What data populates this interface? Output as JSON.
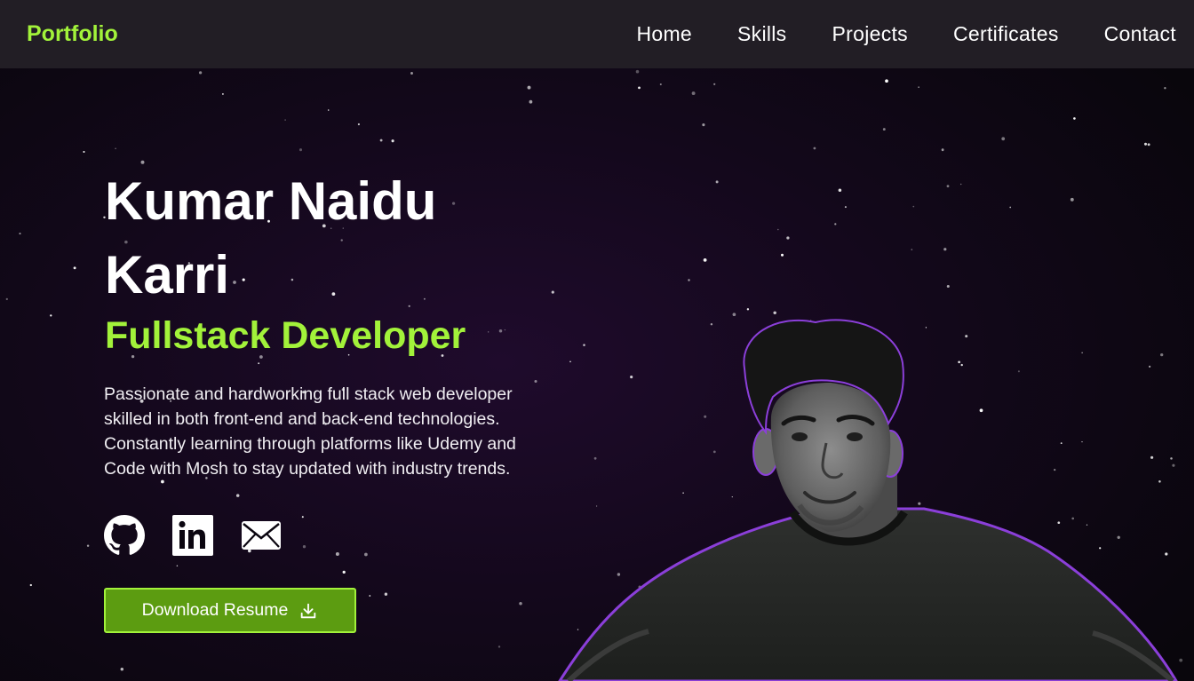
{
  "nav": {
    "brand": "Portfolio",
    "links": [
      "Home",
      "Skills",
      "Projects",
      "Certificates",
      "Contact"
    ]
  },
  "hero": {
    "name": "Kumar Naidu Karri",
    "role": "Fullstack Developer",
    "bio": "Passionate and hardworking full stack web developer skilled in both front-end and back-end technologies. Constantly learning through platforms like Udemy and Code with Mosh to stay updated with industry trends.",
    "socials": [
      {
        "icon": "github-icon"
      },
      {
        "icon": "linkedin-icon"
      },
      {
        "icon": "mail-icon"
      }
    ],
    "resume_button": "Download Resume",
    "resume_icon": "download-icon"
  },
  "colors": {
    "accent": "#a2f23a",
    "button": "#5c9c11",
    "navbar": "#221e25",
    "background": "#13081b",
    "portrait_glow": "#8b3fd9"
  }
}
